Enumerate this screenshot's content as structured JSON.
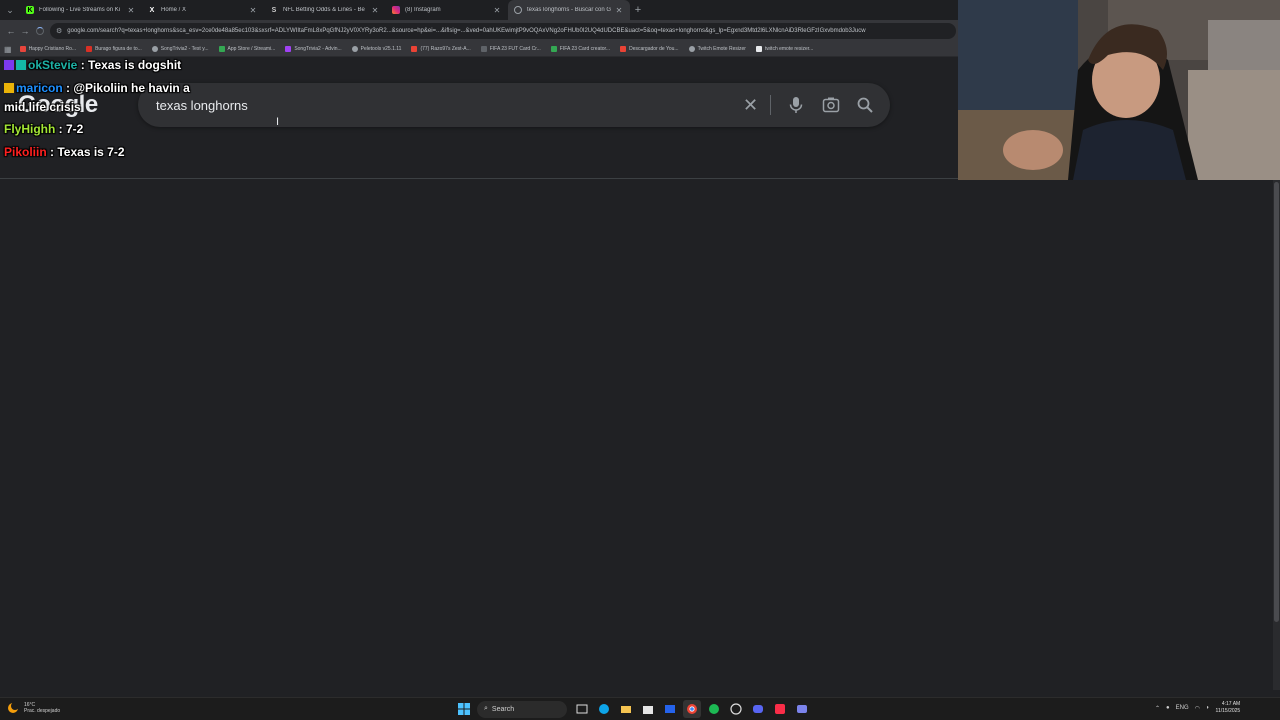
{
  "tabs": [
    {
      "title": "Following - Live Streams on Ki",
      "favicon": "kick-icon",
      "color": "#53fc18",
      "active": false
    },
    {
      "title": "Home / X",
      "favicon": "x-icon",
      "color": "#ffffff",
      "active": false
    },
    {
      "title": "NFL Betting Odds & Lines - Be",
      "favicon": "betting-site-icon",
      "color": "#cccccc",
      "active": false
    },
    {
      "title": "(8) Instagram",
      "favicon": "instagram-icon",
      "color": "#e1306c",
      "active": false
    },
    {
      "title": "texas longhorns - Buscar con G",
      "favicon": "google-icon",
      "color": "#8ab4f8",
      "active": true
    }
  ],
  "address_bar": {
    "url": "google.com/search?q=texas+longhorns&sca_esv=2ce0de48a85ec103&sxsrf=ADLYWIItaFmL8xPqGfNJ2yV0XYRy3oR2...&source=hp&ei=...&iflsig=...&ved=0ahUKEwimjtP9vOQAxVNg2oFHUb0I2UQ4dUDCBE&uact=5&oq=texas+longhorns&gs_lp=Egxnd3Mtd2l6LXNlcnAiD3RleGFzIGxvbmdob3Jucw"
  },
  "bookmarks": [
    {
      "label": "Happy Cristiano Ro...",
      "color": "#e8453c"
    },
    {
      "label": "Burago figura de to...",
      "color": "#d93025"
    },
    {
      "label": "SongTrivia2 - Test y...",
      "color": "#9aa0a6"
    },
    {
      "label": "App Store / Streami...",
      "color": "#34a853"
    },
    {
      "label": "SongTrivia2 - Advin...",
      "color": "#a142f4"
    },
    {
      "label": "Peletools v25.1.11",
      "color": "#9aa0a6"
    },
    {
      "label": "(77) Razo97s Zest-A...",
      "color": "#ea4335"
    },
    {
      "label": "FIFA 23 FUT Card Cr...",
      "color": "#5f6368"
    },
    {
      "label": "FIFA 23 Card creator...",
      "color": "#34a853"
    },
    {
      "label": "Descargador de You...",
      "color": "#ea4335"
    },
    {
      "label": "Twitch Emote Resizer",
      "color": "#9aa0a6"
    },
    {
      "label": "twitch emote resizer...",
      "color": "#e8eaed"
    }
  ],
  "google": {
    "logo": "Google",
    "query": "texas longhorns"
  },
  "chat": [
    {
      "user": "okStevie",
      "user_color": "#1db2a5",
      "text": " : Texas is dogshit"
    },
    {
      "user": "maricon",
      "user_color": "#1e90ff",
      "text": " : @Pikoliin he havin a"
    },
    {
      "user": "",
      "user_color": "#ffffff",
      "text": "mid life crisis"
    },
    {
      "user": "FlyHighh",
      "user_color": "#a3e635",
      "text": " : 7-2"
    },
    {
      "user": "Pikoliin",
      "user_color": "#ff2020",
      "text": " : Texas is 7-2"
    }
  ],
  "taskbar": {
    "weather_temp": "16°C",
    "weather_desc": "Prac. despejado",
    "search_label": "Search",
    "language": "ENG",
    "time": "4:17 AM",
    "date": "11/15/2025"
  }
}
